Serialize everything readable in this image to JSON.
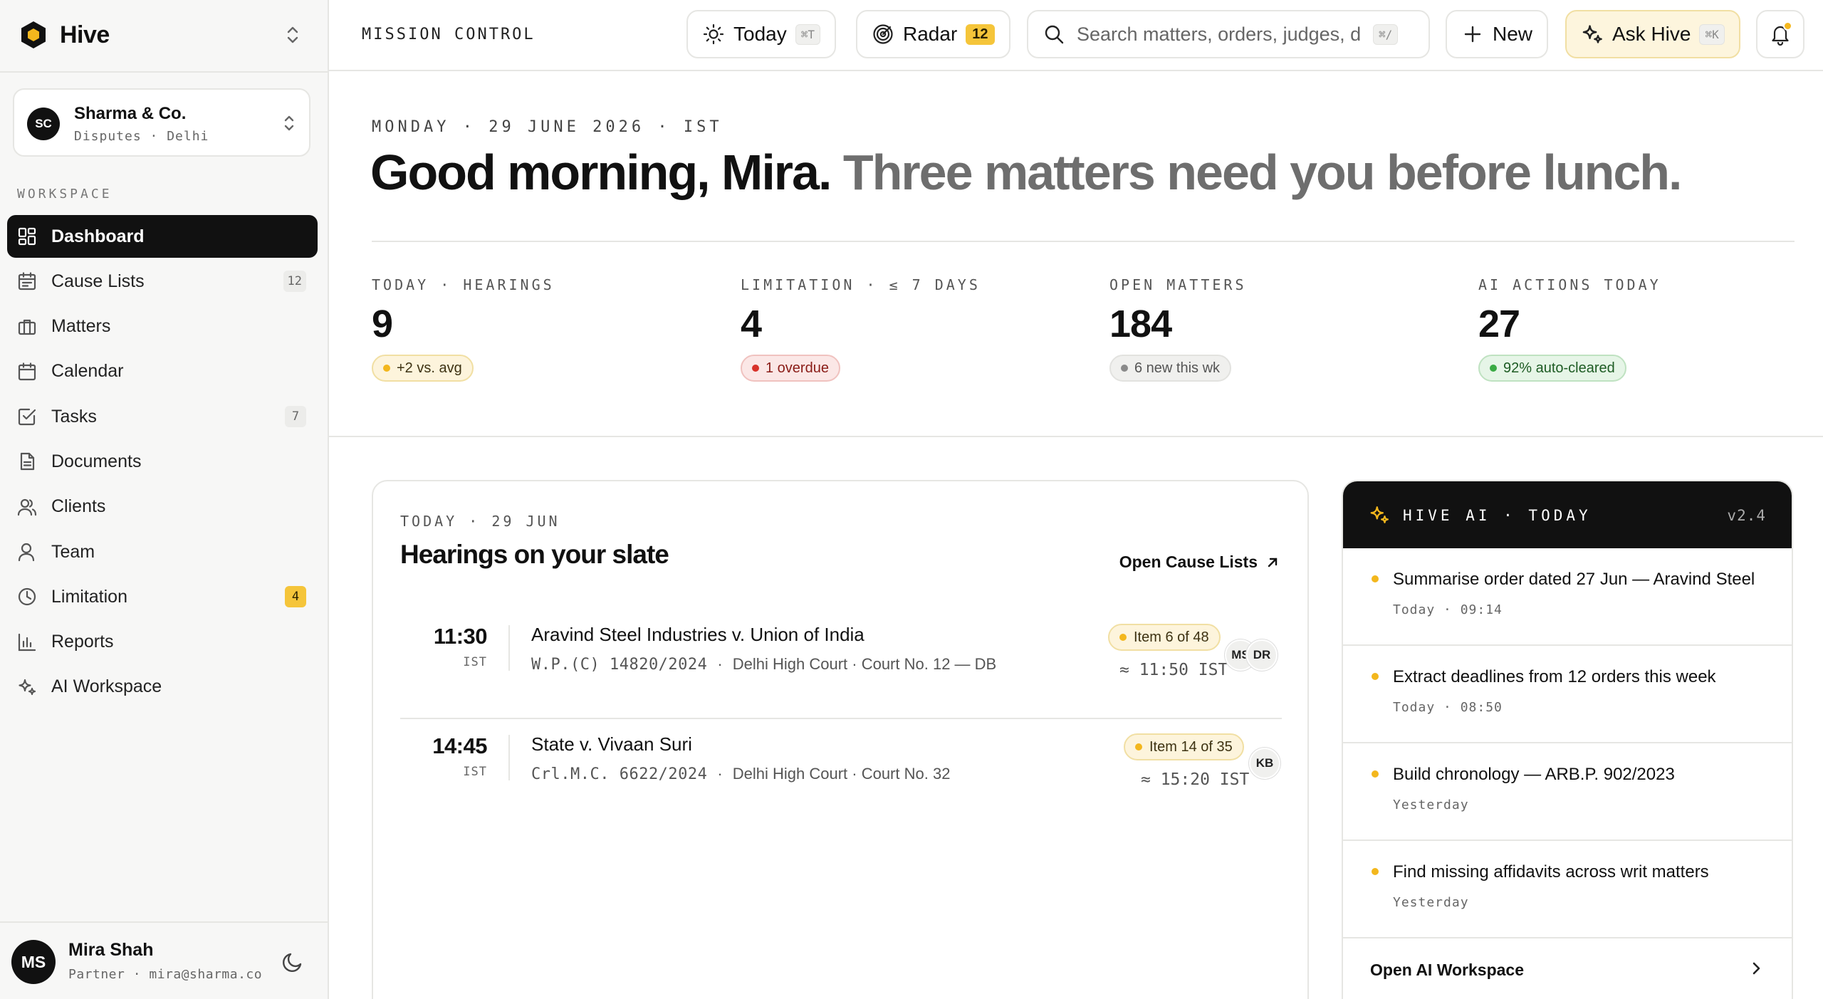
{
  "app": {
    "name": "Hive"
  },
  "org": {
    "initials": "SC",
    "name": "Sharma & Co.",
    "sub": "Disputes · Delhi"
  },
  "sidebar": {
    "section_label": "WORKSPACE",
    "items": [
      {
        "label": "Dashboard",
        "icon": "dashboard-icon",
        "count": ""
      },
      {
        "label": "Cause Lists",
        "icon": "calendar-list-icon",
        "count": "12"
      },
      {
        "label": "Matters",
        "icon": "briefcase-icon",
        "count": ""
      },
      {
        "label": "Calendar",
        "icon": "calendar-icon",
        "count": ""
      },
      {
        "label": "Tasks",
        "icon": "checkbox-icon",
        "count": "7"
      },
      {
        "label": "Documents",
        "icon": "document-icon",
        "count": ""
      },
      {
        "label": "Clients",
        "icon": "users-icon",
        "count": ""
      },
      {
        "label": "Team",
        "icon": "user-icon",
        "count": ""
      },
      {
        "label": "Limitation",
        "icon": "clock-icon",
        "count": "4"
      },
      {
        "label": "Reports",
        "icon": "bar-chart-icon",
        "count": ""
      },
      {
        "label": "AI Workspace",
        "icon": "sparkle-icon",
        "count": ""
      }
    ]
  },
  "user": {
    "initials": "MS",
    "name": "Mira Shah",
    "sub": "Partner · mira@sharma.co"
  },
  "topbar": {
    "crumb": "MISSION CONTROL",
    "today_label": "Today",
    "today_kbd": "⌘T",
    "radar_label": "Radar",
    "radar_count": "12",
    "search_placeholder": "Search matters, orders, judges, d...",
    "search_kbd": "⌘/",
    "new_label": "New",
    "ask_label": "Ask Hive",
    "ask_kbd": "⌘K"
  },
  "hero": {
    "dateline": "MONDAY · 29 JUNE 2026 · IST",
    "greeting": "Good morning, Mira.",
    "greeting_sub": "Three matters need you before lunch."
  },
  "stats": [
    {
      "label": "TODAY · HEARINGS",
      "value": "9",
      "pill": "+2 vs. avg",
      "tone": "amber"
    },
    {
      "label": "LIMITATION · ≤ 7 DAYS",
      "value": "4",
      "pill": "1 overdue",
      "tone": "red"
    },
    {
      "label": "OPEN MATTERS",
      "value": "184",
      "pill": "6 new this wk",
      "tone": "gray"
    },
    {
      "label": "AI ACTIONS TODAY",
      "value": "27",
      "pill": "92% auto-cleared",
      "tone": "green"
    }
  ],
  "hearings": {
    "kicker": "TODAY · 29 JUN",
    "title": "Hearings on your slate",
    "link": "Open Cause Lists",
    "rows": [
      {
        "time": "11:30",
        "tz": "IST",
        "title": "Aravind Steel Industries v. Union of India",
        "case_no": "W.P.(C) 14820/2024",
        "court": "Delhi High Court · Court No. 12 — DB",
        "item": "Item 6 of 48",
        "eta": "≈ 11:50 IST",
        "avatars": [
          "MS",
          "DR"
        ]
      },
      {
        "time": "14:45",
        "tz": "IST",
        "title": "State v. Vivaan Suri",
        "case_no": "Crl.M.C. 6622/2024",
        "court": "Delhi High Court · Court No. 32",
        "item": "Item 14 of 35",
        "eta": "≈ 15:20 IST",
        "avatars": [
          "KB"
        ]
      }
    ]
  },
  "ai": {
    "label": "HIVE AI · TODAY",
    "version": "v2.4",
    "items": [
      {
        "text": "Summarise order dated 27 Jun — Aravind Steel",
        "time": "Today · 09:14"
      },
      {
        "text": "Extract deadlines from 12 orders this week",
        "time": "Today · 08:50"
      },
      {
        "text": "Build chronology — ARB.P. 902/2023",
        "time": "Yesterday"
      },
      {
        "text": "Find missing affidavits across writ matters",
        "time": "Yesterday"
      }
    ],
    "footer": "Open AI Workspace"
  },
  "colors": {
    "accent": "#f5c53a",
    "ink": "#111111",
    "danger": "#d8322a",
    "success": "#3aaa44"
  }
}
